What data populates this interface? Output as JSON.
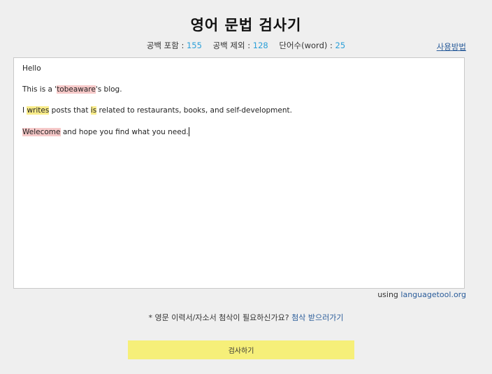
{
  "header": {
    "title": "영어 문법 검사기",
    "howto_link": "사용방법"
  },
  "counts": {
    "with_space_label": "공백 포함 :",
    "with_space_value": "155",
    "without_space_label": "공백 제외 :",
    "without_space_value": "128",
    "words_label": "단어수(word) :",
    "words_value": "25"
  },
  "editor": {
    "line1": "Hello",
    "line2_pre": "This is a '",
    "line2_err": "tobeaware",
    "line2_post": "'s blog.",
    "line3_pre": "I ",
    "line3_err1": "writes",
    "line3_mid": " posts that ",
    "line3_err2": "is",
    "line3_post": " related to restaurants, books, and self-development.",
    "line4_err": "Welecome",
    "line4_post": " and hope you find what you need.",
    "colors": {
      "spelling_highlight": "#f6c9c9",
      "grammar_highlight": "#f9ec8a"
    }
  },
  "credit": {
    "prefix": "using",
    "service": "languagetool.org"
  },
  "promo": {
    "text": "* 영문 이력서/자소서 첨삭이 필요하신가요?",
    "link": "첨삭 받으러가기"
  },
  "actions": {
    "check_button": "검사하기",
    "button_color": "#f6ef79"
  }
}
